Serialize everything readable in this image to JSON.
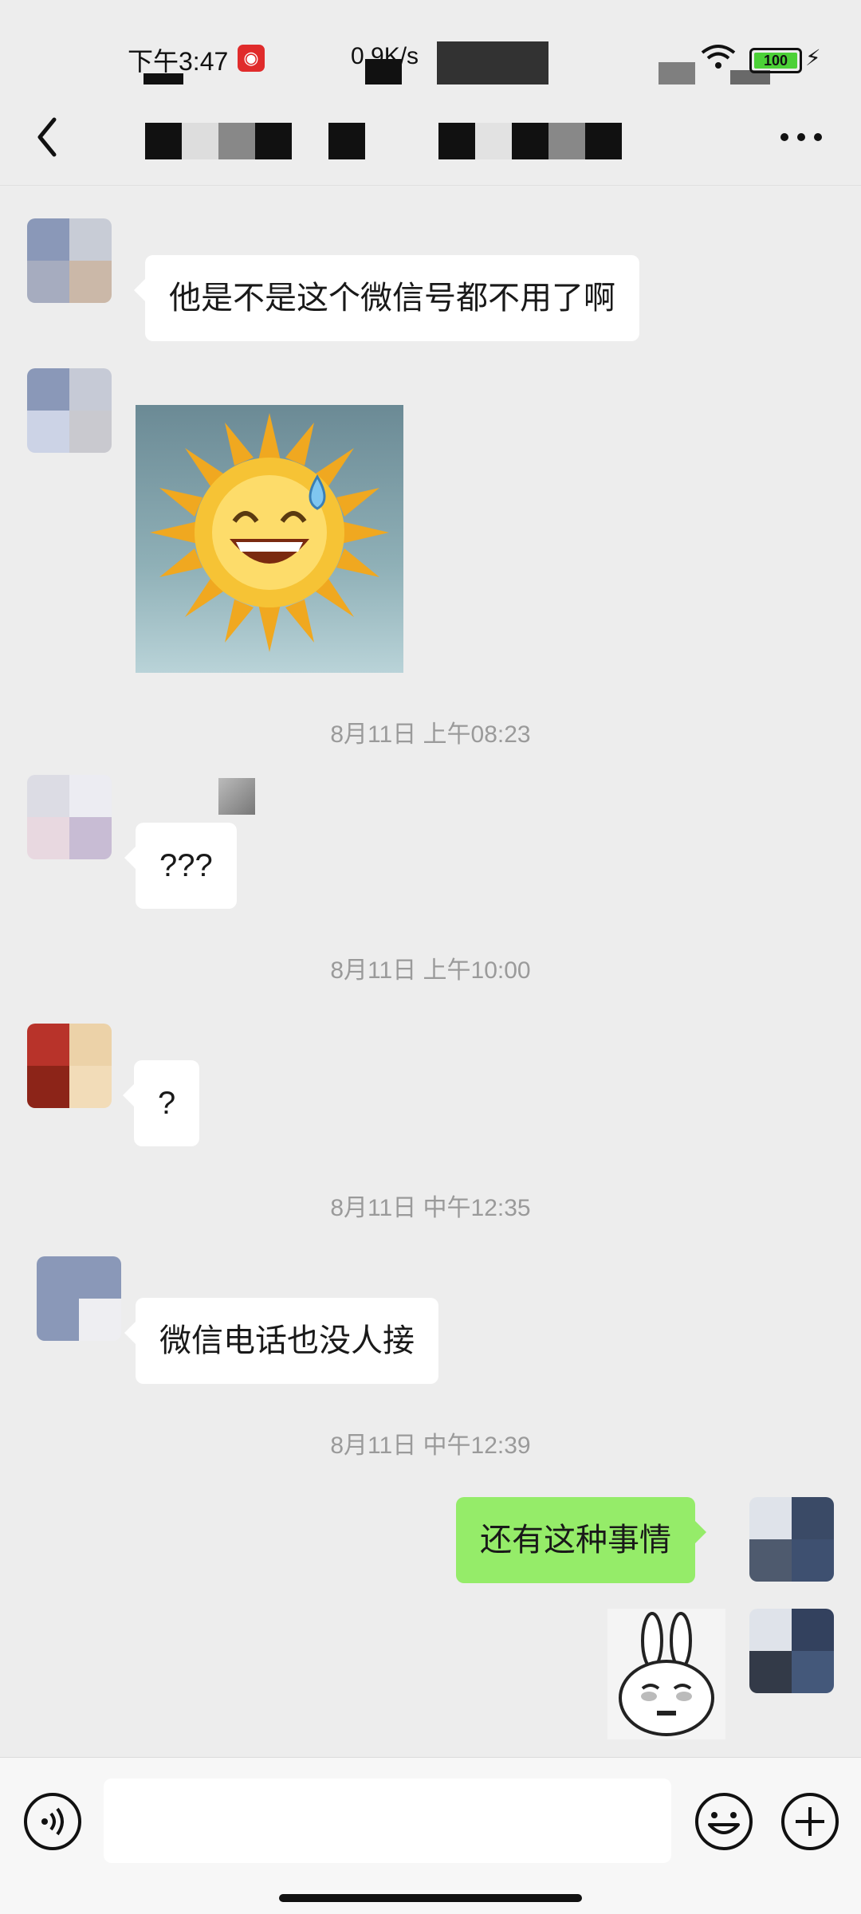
{
  "status_bar": {
    "time": "下午3:47",
    "net_speed": "0.9K/s",
    "battery": "100"
  },
  "header": {
    "title": ""
  },
  "messages": [
    {
      "id": "m1",
      "side": "left",
      "type": "text",
      "text": "他是不是这个微信号都不用了啊"
    },
    {
      "id": "m2",
      "side": "left",
      "type": "image",
      "content": "sweating sun emoji sticker"
    },
    {
      "id": "t1",
      "type": "timestamp",
      "text": "8月11日 上午08:23"
    },
    {
      "id": "m3",
      "side": "left",
      "type": "text",
      "text": "???"
    },
    {
      "id": "t2",
      "type": "timestamp",
      "text": "8月11日 上午10:00"
    },
    {
      "id": "m4",
      "side": "left",
      "type": "text",
      "text": "?"
    },
    {
      "id": "t3",
      "type": "timestamp",
      "text": "8月11日 中午12:35"
    },
    {
      "id": "m5",
      "side": "left",
      "type": "text",
      "text": "微信电话也没人接"
    },
    {
      "id": "t4",
      "type": "timestamp",
      "text": "8月11日 中午12:39"
    },
    {
      "id": "m6",
      "side": "right",
      "type": "text",
      "text": "还有这种事情"
    },
    {
      "id": "m7",
      "side": "right",
      "type": "image",
      "content": "rabbit face sticker"
    }
  ],
  "input_bar": {
    "voice_icon": "voice-icon",
    "emoji_icon": "emoji-icon",
    "plus_icon": "plus-icon",
    "placeholder": ""
  },
  "colors": {
    "background": "#ededed",
    "sent_bubble": "#95ec69",
    "received_bubble": "#ffffff",
    "timestamp": "#9a9a9a"
  }
}
